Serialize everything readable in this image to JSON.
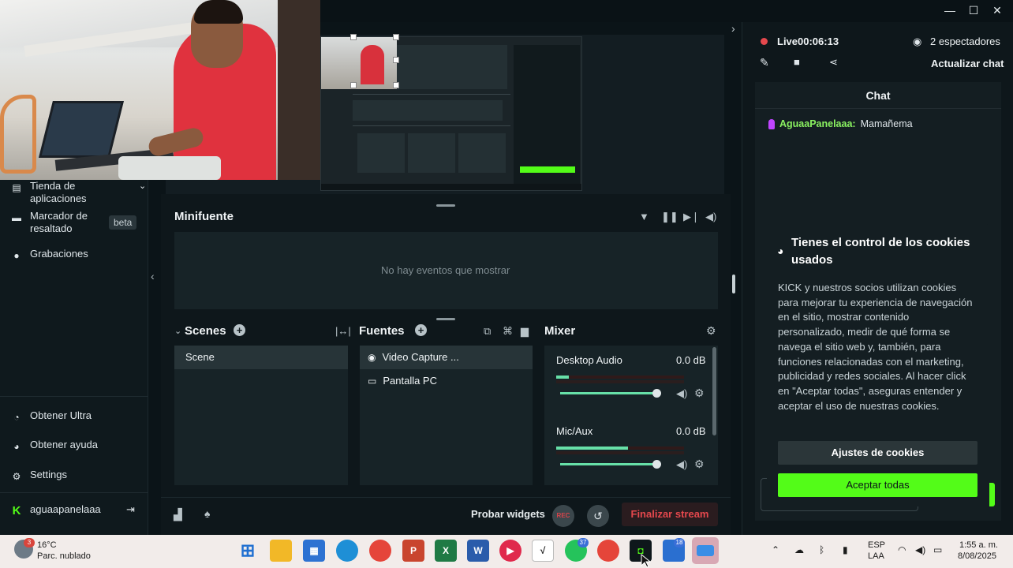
{
  "window": {
    "minimize": "—",
    "maximize": "☐",
    "close": "✕",
    "collapse_right": "›"
  },
  "sidebar": {
    "items": [
      {
        "label": "Tienda de aplicaciones",
        "icon": "store-icon"
      },
      {
        "label": "Marcador de resaltado",
        "icon": "highlight-icon",
        "badge": "beta"
      },
      {
        "label": "Grabaciones",
        "icon": "recordings-icon"
      }
    ],
    "bottom_items": [
      {
        "label": "Obtener Ultra",
        "icon": "ultra-icon"
      },
      {
        "label": "Obtener ayuda",
        "icon": "help-icon"
      },
      {
        "label": "Settings",
        "icon": "gear-icon"
      }
    ],
    "user": {
      "name": "aguaapanelaaa",
      "logo": "K"
    },
    "collapse": "‹"
  },
  "minifuente": {
    "title": "Minifuente",
    "empty": "No hay eventos que mostrar"
  },
  "scenes": {
    "title": "Scenes",
    "items": [
      "Scene"
    ]
  },
  "fuentes": {
    "title": "Fuentes",
    "items": [
      {
        "label": "Video Capture ...",
        "icon": "webcam-icon",
        "selected": true
      },
      {
        "label": "Pantalla PC",
        "icon": "monitor-icon",
        "selected": false
      }
    ]
  },
  "mixer": {
    "title": "Mixer",
    "channels": [
      {
        "name": "Desktop Audio",
        "db": "0.0 dB",
        "level": 0.1,
        "volume": 1.0
      },
      {
        "name": "Mic/Aux",
        "db": "0.0 dB",
        "level": 0.56,
        "volume": 1.0
      }
    ]
  },
  "bottombar": {
    "test_widgets": "Probar widgets",
    "rec": "REC",
    "end_stream": "Finalizar stream"
  },
  "stream": {
    "live_label": "Live",
    "time": "00:06:13",
    "viewers": "2 espectadores",
    "refresh_chat": "Actualizar chat"
  },
  "chat": {
    "title": "Chat",
    "messages": [
      {
        "user": "AguaaPanelaaa:",
        "text": "Mamañema"
      }
    ]
  },
  "cookie": {
    "title": "Tienes el control de los cookies usados",
    "body": "KICK y nuestros socios utilizan cookies para mejorar tu experiencia de navegación en el sitio, mostrar contenido personalizado, medir de qué forma se navega el sitio web y, también, para funciones relacionadas con el marketing, publicidad y redes sociales. Al hacer click en \"Aceptar todas\", aseguras entender y aceptar el uso de nuestras cookies.",
    "settings": "Ajustes de cookies",
    "accept": "Aceptar todas"
  },
  "taskbar": {
    "weather_temp": "16°C",
    "weather_desc": "Parc. nublado",
    "weather_badge": "3",
    "lang_top": "ESP",
    "lang_bottom": "LAA",
    "time": "1:55 a. m.",
    "date": "8/08/2025",
    "whatsapp_badge": "37",
    "app_badge": "18"
  },
  "colors": {
    "kick_green": "#53fc18",
    "live_red": "#e5484d",
    "meter_green": "#67e0a8"
  }
}
